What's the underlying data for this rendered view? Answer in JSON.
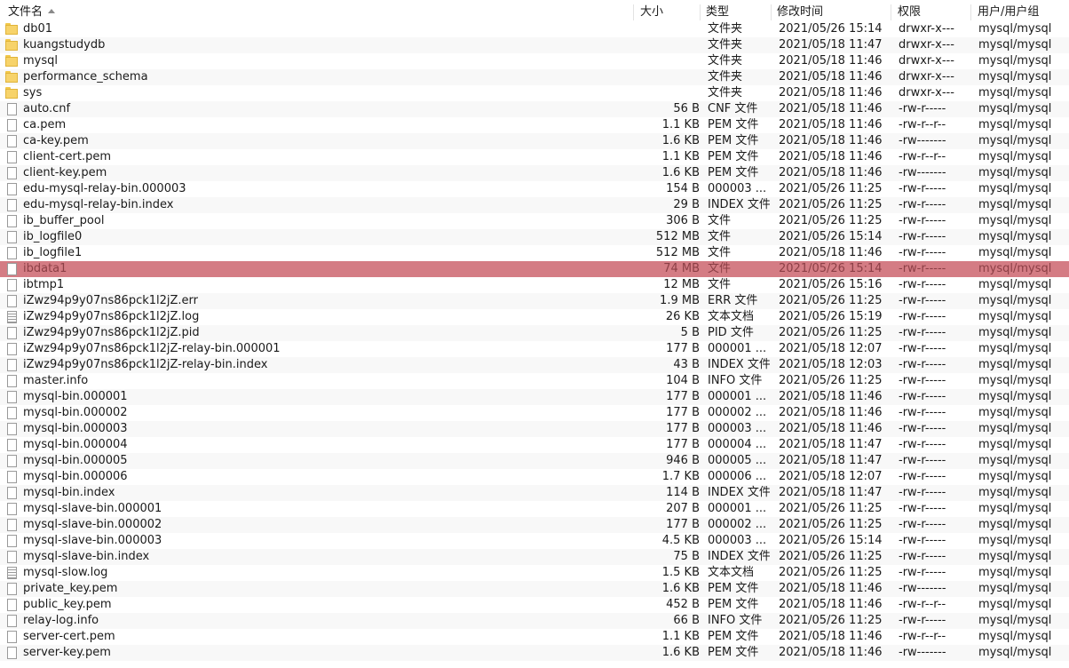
{
  "header": {
    "name": "文件名",
    "size": "大小",
    "type": "类型",
    "mtime": "修改时间",
    "perm": "权限",
    "owner": "用户/用户组"
  },
  "colors": {
    "selection": "#d47c84",
    "folder": "#f7d36a"
  },
  "files": [
    {
      "name": "db01",
      "size": "",
      "type": "文件夹",
      "mtime": "2021/05/26 15:14",
      "perm": "drwxr-x---",
      "owner": "mysql/mysql",
      "icon": "folder-icon"
    },
    {
      "name": "kuangstudydb",
      "size": "",
      "type": "文件夹",
      "mtime": "2021/05/18 11:47",
      "perm": "drwxr-x---",
      "owner": "mysql/mysql",
      "icon": "folder-icon"
    },
    {
      "name": "mysql",
      "size": "",
      "type": "文件夹",
      "mtime": "2021/05/18 11:46",
      "perm": "drwxr-x---",
      "owner": "mysql/mysql",
      "icon": "folder-icon"
    },
    {
      "name": "performance_schema",
      "size": "",
      "type": "文件夹",
      "mtime": "2021/05/18 11:46",
      "perm": "drwxr-x---",
      "owner": "mysql/mysql",
      "icon": "folder-icon"
    },
    {
      "name": "sys",
      "size": "",
      "type": "文件夹",
      "mtime": "2021/05/18 11:46",
      "perm": "drwxr-x---",
      "owner": "mysql/mysql",
      "icon": "folder-icon"
    },
    {
      "name": "auto.cnf",
      "size": "56 B",
      "type": "CNF 文件",
      "mtime": "2021/05/18 11:46",
      "perm": "-rw-r-----",
      "owner": "mysql/mysql",
      "icon": "file-icon"
    },
    {
      "name": "ca.pem",
      "size": "1.1 KB",
      "type": "PEM 文件",
      "mtime": "2021/05/18 11:46",
      "perm": "-rw-r--r--",
      "owner": "mysql/mysql",
      "icon": "file-icon"
    },
    {
      "name": "ca-key.pem",
      "size": "1.6 KB",
      "type": "PEM 文件",
      "mtime": "2021/05/18 11:46",
      "perm": "-rw-------",
      "owner": "mysql/mysql",
      "icon": "file-icon"
    },
    {
      "name": "client-cert.pem",
      "size": "1.1 KB",
      "type": "PEM 文件",
      "mtime": "2021/05/18 11:46",
      "perm": "-rw-r--r--",
      "owner": "mysql/mysql",
      "icon": "file-icon"
    },
    {
      "name": "client-key.pem",
      "size": "1.6 KB",
      "type": "PEM 文件",
      "mtime": "2021/05/18 11:46",
      "perm": "-rw-------",
      "owner": "mysql/mysql",
      "icon": "file-icon"
    },
    {
      "name": "edu-mysql-relay-bin.000003",
      "size": "154 B",
      "type": "000003 ...",
      "mtime": "2021/05/26 11:25",
      "perm": "-rw-r-----",
      "owner": "mysql/mysql",
      "icon": "file-icon"
    },
    {
      "name": "edu-mysql-relay-bin.index",
      "size": "29 B",
      "type": "INDEX 文件",
      "mtime": "2021/05/26 11:25",
      "perm": "-rw-r-----",
      "owner": "mysql/mysql",
      "icon": "file-icon"
    },
    {
      "name": "ib_buffer_pool",
      "size": "306 B",
      "type": "文件",
      "mtime": "2021/05/26 11:25",
      "perm": "-rw-r-----",
      "owner": "mysql/mysql",
      "icon": "file-icon"
    },
    {
      "name": "ib_logfile0",
      "size": "512 MB",
      "type": "文件",
      "mtime": "2021/05/26 15:14",
      "perm": "-rw-r-----",
      "owner": "mysql/mysql",
      "icon": "file-icon"
    },
    {
      "name": "ib_logfile1",
      "size": "512 MB",
      "type": "文件",
      "mtime": "2021/05/18 11:46",
      "perm": "-rw-r-----",
      "owner": "mysql/mysql",
      "icon": "file-icon"
    },
    {
      "name": "ibdata1",
      "size": "74 MB",
      "type": "文件",
      "mtime": "2021/05/26 15:14",
      "perm": "-rw-r-----",
      "owner": "mysql/mysql",
      "icon": "file-icon",
      "selected": true
    },
    {
      "name": "ibtmp1",
      "size": "12 MB",
      "type": "文件",
      "mtime": "2021/05/26 15:16",
      "perm": "-rw-r-----",
      "owner": "mysql/mysql",
      "icon": "file-icon"
    },
    {
      "name": "iZwz94p9y07ns86pck1l2jZ.err",
      "size": "1.9 MB",
      "type": "ERR 文件",
      "mtime": "2021/05/26 11:25",
      "perm": "-rw-r-----",
      "owner": "mysql/mysql",
      "icon": "file-icon"
    },
    {
      "name": "iZwz94p9y07ns86pck1l2jZ.log",
      "size": "26 KB",
      "type": "文本文档",
      "mtime": "2021/05/26 15:19",
      "perm": "-rw-r-----",
      "owner": "mysql/mysql",
      "icon": "text-doc-icon"
    },
    {
      "name": "iZwz94p9y07ns86pck1l2jZ.pid",
      "size": "5 B",
      "type": "PID 文件",
      "mtime": "2021/05/26 11:25",
      "perm": "-rw-r-----",
      "owner": "mysql/mysql",
      "icon": "file-icon"
    },
    {
      "name": "iZwz94p9y07ns86pck1l2jZ-relay-bin.000001",
      "size": "177 B",
      "type": "000001 ...",
      "mtime": "2021/05/18 12:07",
      "perm": "-rw-r-----",
      "owner": "mysql/mysql",
      "icon": "file-icon"
    },
    {
      "name": "iZwz94p9y07ns86pck1l2jZ-relay-bin.index",
      "size": "43 B",
      "type": "INDEX 文件",
      "mtime": "2021/05/18 12:03",
      "perm": "-rw-r-----",
      "owner": "mysql/mysql",
      "icon": "file-icon"
    },
    {
      "name": "master.info",
      "size": "104 B",
      "type": "INFO 文件",
      "mtime": "2021/05/26 11:25",
      "perm": "-rw-r-----",
      "owner": "mysql/mysql",
      "icon": "file-icon"
    },
    {
      "name": "mysql-bin.000001",
      "size": "177 B",
      "type": "000001 ...",
      "mtime": "2021/05/18 11:46",
      "perm": "-rw-r-----",
      "owner": "mysql/mysql",
      "icon": "file-icon"
    },
    {
      "name": "mysql-bin.000002",
      "size": "177 B",
      "type": "000002 ...",
      "mtime": "2021/05/18 11:46",
      "perm": "-rw-r-----",
      "owner": "mysql/mysql",
      "icon": "file-icon"
    },
    {
      "name": "mysql-bin.000003",
      "size": "177 B",
      "type": "000003 ...",
      "mtime": "2021/05/18 11:46",
      "perm": "-rw-r-----",
      "owner": "mysql/mysql",
      "icon": "file-icon"
    },
    {
      "name": "mysql-bin.000004",
      "size": "177 B",
      "type": "000004 ...",
      "mtime": "2021/05/18 11:47",
      "perm": "-rw-r-----",
      "owner": "mysql/mysql",
      "icon": "file-icon"
    },
    {
      "name": "mysql-bin.000005",
      "size": "946 B",
      "type": "000005 ...",
      "mtime": "2021/05/18 11:47",
      "perm": "-rw-r-----",
      "owner": "mysql/mysql",
      "icon": "file-icon"
    },
    {
      "name": "mysql-bin.000006",
      "size": "1.7 KB",
      "type": "000006 ...",
      "mtime": "2021/05/18 12:07",
      "perm": "-rw-r-----",
      "owner": "mysql/mysql",
      "icon": "file-icon"
    },
    {
      "name": "mysql-bin.index",
      "size": "114 B",
      "type": "INDEX 文件",
      "mtime": "2021/05/18 11:47",
      "perm": "-rw-r-----",
      "owner": "mysql/mysql",
      "icon": "file-icon"
    },
    {
      "name": "mysql-slave-bin.000001",
      "size": "207 B",
      "type": "000001 ...",
      "mtime": "2021/05/26 11:25",
      "perm": "-rw-r-----",
      "owner": "mysql/mysql",
      "icon": "file-icon"
    },
    {
      "name": "mysql-slave-bin.000002",
      "size": "177 B",
      "type": "000002 ...",
      "mtime": "2021/05/26 11:25",
      "perm": "-rw-r-----",
      "owner": "mysql/mysql",
      "icon": "file-icon"
    },
    {
      "name": "mysql-slave-bin.000003",
      "size": "4.5 KB",
      "type": "000003 ...",
      "mtime": "2021/05/26 15:14",
      "perm": "-rw-r-----",
      "owner": "mysql/mysql",
      "icon": "file-icon"
    },
    {
      "name": "mysql-slave-bin.index",
      "size": "75 B",
      "type": "INDEX 文件",
      "mtime": "2021/05/26 11:25",
      "perm": "-rw-r-----",
      "owner": "mysql/mysql",
      "icon": "file-icon"
    },
    {
      "name": "mysql-slow.log",
      "size": "1.5 KB",
      "type": "文本文档",
      "mtime": "2021/05/26 11:25",
      "perm": "-rw-r-----",
      "owner": "mysql/mysql",
      "icon": "text-doc-icon"
    },
    {
      "name": "private_key.pem",
      "size": "1.6 KB",
      "type": "PEM 文件",
      "mtime": "2021/05/18 11:46",
      "perm": "-rw-------",
      "owner": "mysql/mysql",
      "icon": "file-icon"
    },
    {
      "name": "public_key.pem",
      "size": "452 B",
      "type": "PEM 文件",
      "mtime": "2021/05/18 11:46",
      "perm": "-rw-r--r--",
      "owner": "mysql/mysql",
      "icon": "file-icon"
    },
    {
      "name": "relay-log.info",
      "size": "66 B",
      "type": "INFO 文件",
      "mtime": "2021/05/26 11:25",
      "perm": "-rw-r-----",
      "owner": "mysql/mysql",
      "icon": "file-icon"
    },
    {
      "name": "server-cert.pem",
      "size": "1.1 KB",
      "type": "PEM 文件",
      "mtime": "2021/05/18 11:46",
      "perm": "-rw-r--r--",
      "owner": "mysql/mysql",
      "icon": "file-icon"
    },
    {
      "name": "server-key.pem",
      "size": "1.6 KB",
      "type": "PEM 文件",
      "mtime": "2021/05/18 11:46",
      "perm": "-rw-------",
      "owner": "mysql/mysql",
      "icon": "file-icon"
    }
  ]
}
